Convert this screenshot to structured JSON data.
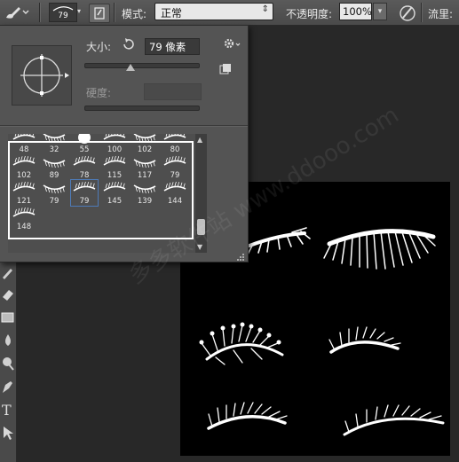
{
  "options_bar": {
    "brush_size_value": "79",
    "mode_label": "模式:",
    "mode_value": "正常",
    "opacity_label": "不透明度:",
    "opacity_value": "100%",
    "flow_label": "流里:"
  },
  "brush_picker": {
    "size_label": "大小:",
    "size_value": "79 像素",
    "size_level": 0.41,
    "hardness_label": "硬度:",
    "hardness_value": ""
  },
  "presets": {
    "rows": [
      [
        "48",
        "32",
        "55",
        "100",
        "102",
        "80"
      ],
      [
        "102",
        "89",
        "78",
        "115",
        "117",
        "79"
      ],
      [
        "121",
        "79",
        "79",
        "145",
        "139",
        "144"
      ],
      [
        "148"
      ]
    ],
    "selected_index": 14
  },
  "watermark": "多多软件站  www.ddooo.com",
  "colors": {
    "panel": "#545454",
    "selection": "#4e7bb8",
    "canvas": "#000000"
  }
}
